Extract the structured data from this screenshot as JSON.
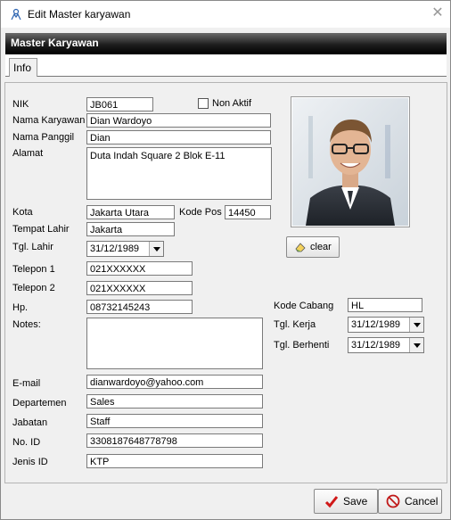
{
  "window": {
    "title": "Edit Master karyawan"
  },
  "header": {
    "title": "Master Karyawan"
  },
  "tabs": [
    {
      "label": "Info"
    }
  ],
  "form": {
    "nik": {
      "label": "NIK",
      "value": "JB061"
    },
    "non_aktif": {
      "label": "Non Aktif",
      "checked": false
    },
    "nama_karyawan": {
      "label": "Nama Karyawan",
      "value": "Dian Wardoyo"
    },
    "nama_panggil": {
      "label": "Nama Panggil",
      "value": "Dian"
    },
    "alamat": {
      "label": "Alamat",
      "value": "Duta Indah Square 2 Blok E-11"
    },
    "kota": {
      "label": "Kota",
      "value": "Jakarta Utara"
    },
    "kode_pos": {
      "label": "Kode Pos",
      "value": "14450"
    },
    "tempat_lahir": {
      "label": "Tempat Lahir",
      "value": "Jakarta"
    },
    "tgl_lahir": {
      "label": "Tgl. Lahir",
      "value": "31/12/1989"
    },
    "telepon1": {
      "label": "Telepon 1",
      "value": "021XXXXXX"
    },
    "telepon2": {
      "label": "Telepon 2",
      "value": "021XXXXXX"
    },
    "hp": {
      "label": "Hp.",
      "value": "08732145243"
    },
    "notes": {
      "label": "Notes:",
      "value": ""
    },
    "email": {
      "label": "E-mail",
      "value": "dianwardoyo@yahoo.com"
    },
    "departemen": {
      "label": "Departemen",
      "value": "Sales"
    },
    "jabatan": {
      "label": "Jabatan",
      "value": "Staff"
    },
    "no_id": {
      "label": "No. ID",
      "value": "3308187648778798"
    },
    "jenis_id": {
      "label": "Jenis ID",
      "value": "KTP"
    },
    "kode_cabang": {
      "label": "Kode Cabang",
      "value": "HL"
    },
    "tgl_kerja": {
      "label": "Tgl. Kerja",
      "value": "31/12/1989"
    },
    "tgl_berhenti": {
      "label": "Tgl. Berhenti",
      "value": "31/12/1989"
    }
  },
  "photo": {
    "clear_label": "clear"
  },
  "buttons": {
    "save": "Save",
    "cancel": "Cancel"
  }
}
